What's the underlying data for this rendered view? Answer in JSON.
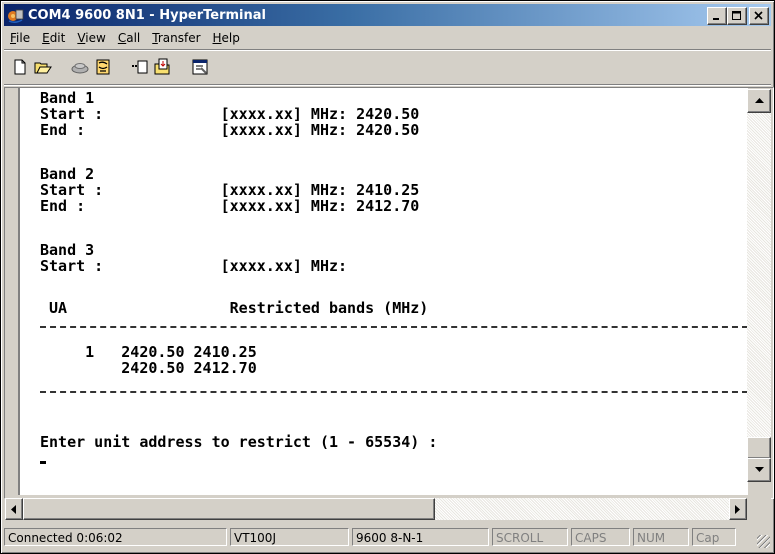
{
  "window": {
    "title": "COM4 9600 8N1 - HyperTerminal",
    "minimize_glyph": "_",
    "maximize_glyph": "□",
    "close_glyph": "×"
  },
  "menu": {
    "items": [
      {
        "label": "File",
        "accel": "F",
        "rest": "ile"
      },
      {
        "label": "Edit",
        "accel": "E",
        "rest": "dit"
      },
      {
        "label": "View",
        "accel": "V",
        "rest": "iew"
      },
      {
        "label": "Call",
        "accel": "C",
        "rest": "all"
      },
      {
        "label": "Transfer",
        "accel": "T",
        "rest": "ransfer"
      },
      {
        "label": "Help",
        "accel": "H",
        "rest": "elp"
      }
    ]
  },
  "toolbar": {
    "buttons": [
      "new-icon",
      "open-icon",
      "call-icon",
      "disconnect-icon",
      "send-icon",
      "receive-icon",
      "properties-icon"
    ]
  },
  "terminal": {
    "lines": [
      "Band 1",
      "Start :             [xxxx.xx] MHz: 2420.50",
      "End :               [xxxx.xx] MHz: 2420.50",
      "",
      "Band 2",
      "Start :             [xxxx.xx] MHz: 2410.25",
      "End :               [xxxx.xx] MHz: 2412.70",
      "",
      "Band 3",
      "Start :             [xxxx.xx] MHz:",
      "",
      " UA                  Restricted bands (MHz)",
      "",
      "     1   2420.50 2410.25",
      "         2420.50 2412.70",
      "",
      "",
      "",
      "Enter unit address to restrict (1 - 65534) :"
    ]
  },
  "statusbar": {
    "connected": "Connected 0:06:02",
    "emulation": "VT100J",
    "settings": "9600 8-N-1",
    "scroll": "SCROLL",
    "caps": "CAPS",
    "num": "NUM",
    "capture": "Cap"
  }
}
